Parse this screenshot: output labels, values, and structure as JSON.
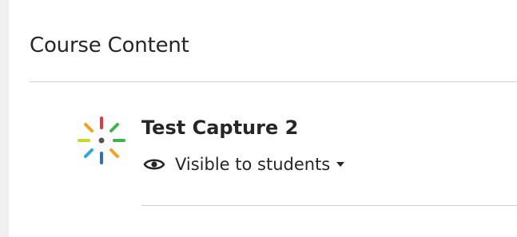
{
  "section": {
    "title": "Course Content"
  },
  "items": [
    {
      "title": "Test Capture 2",
      "icon": "kaltura-capture-icon",
      "visibility": {
        "label": "Visible to students",
        "icon": "eye-icon",
        "dropdown_icon": "caret-down-icon"
      }
    }
  ],
  "colors": {
    "icon_red": "#e03a3e",
    "icon_orange": "#f7a21b",
    "icon_yellow_green": "#c8d92b",
    "icon_green": "#3db54a",
    "icon_blue": "#2f6fbd",
    "icon_cyan": "#29a8df",
    "icon_center": "#555555"
  }
}
